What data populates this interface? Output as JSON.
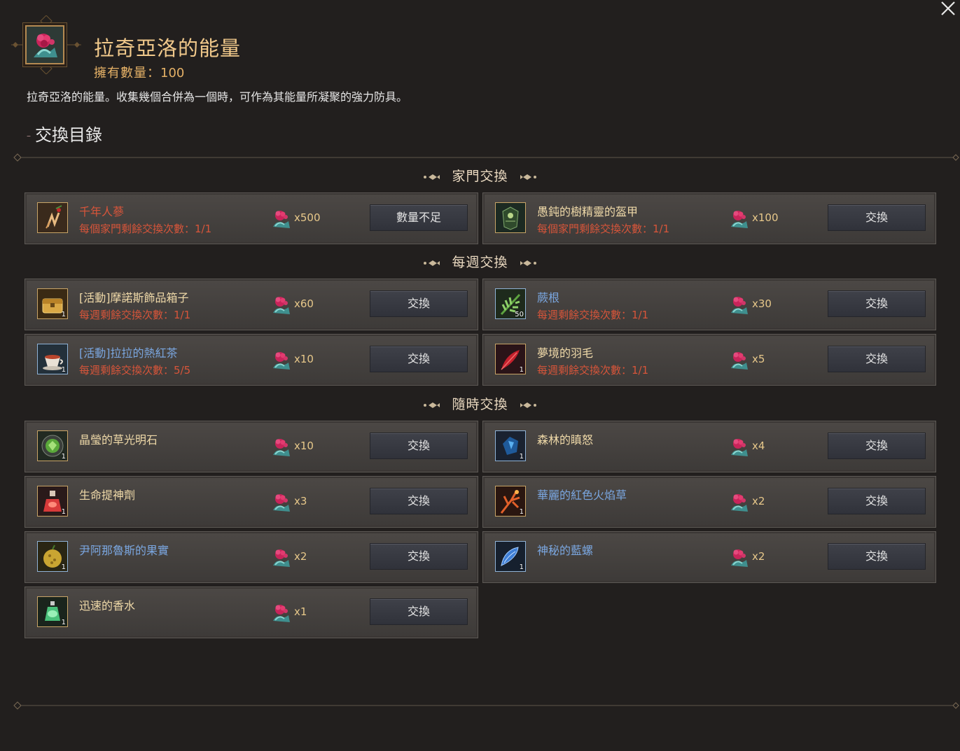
{
  "header": {
    "title": "拉奇亞洛的能量",
    "count_label": "擁有數量：",
    "count_value": "100",
    "description": "拉奇亞洛的能量。收集幾個合併為一個時，可作為其能量所凝聚的強力防具。",
    "section_heading": "交換目錄",
    "icon": "flower-icon"
  },
  "colors": {
    "background": "#221f1e",
    "card": "#45413e",
    "gold_text": "#f1c98b",
    "limit_text": "#d7553a",
    "blue_text": "#7aa6df",
    "button": "#383a42"
  },
  "categories": [
    {
      "title": "家門交換",
      "items": [
        {
          "name": "千年人蔘",
          "limit": "每個家門剩餘交換次數：1/1",
          "cost": "x500",
          "button": "數量不足",
          "icon": "ginseng-icon",
          "name_color": "red"
        },
        {
          "name": "愚鈍的樹精靈的盔甲",
          "limit": "每個家門剩餘交換次數：1/1",
          "cost": "x100",
          "button": "交換",
          "icon": "armor-icon",
          "name_color": "gold"
        }
      ]
    },
    {
      "title": "每週交換",
      "items": [
        {
          "name": "[活動]摩諾斯飾品箱子",
          "limit": "每週剩餘交換次數：1/1",
          "cost": "x60",
          "button": "交換",
          "icon": "chest-icon",
          "stack": "1",
          "name_color": "gold"
        },
        {
          "name": "蕨根",
          "limit": "每週剩餘交換次數：1/1",
          "cost": "x30",
          "button": "交換",
          "icon": "fern-icon",
          "stack": "50",
          "name_color": "blue"
        },
        {
          "name": "[活動]拉拉的熱紅茶",
          "limit": "每週剩餘交換次數：5/5",
          "cost": "x10",
          "button": "交換",
          "icon": "tea-icon",
          "stack": "1",
          "name_color": "blue"
        },
        {
          "name": "夢境的羽毛",
          "limit": "每週剩餘交換次數：1/1",
          "cost": "x5",
          "button": "交換",
          "icon": "feather-icon",
          "stack": "1",
          "name_color": "gold"
        }
      ]
    },
    {
      "title": "隨時交換",
      "items": [
        {
          "name": "晶瑩的草光明石",
          "limit": "",
          "cost": "x10",
          "button": "交換",
          "icon": "green-stone-icon",
          "stack": "1",
          "name_color": "gold"
        },
        {
          "name": "森林的瞋怒",
          "limit": "",
          "cost": "x4",
          "button": "交換",
          "icon": "blue-stone-icon",
          "stack": "1",
          "name_color": "gold"
        },
        {
          "name": "生命提神劑",
          "limit": "",
          "cost": "x3",
          "button": "交換",
          "icon": "potion-icon",
          "stack": "1",
          "name_color": "gold"
        },
        {
          "name": "華麗的紅色火焰草",
          "limit": "",
          "cost": "x2",
          "button": "交換",
          "icon": "flame-herb-icon",
          "stack": "1",
          "name_color": "blue"
        },
        {
          "name": "尹阿那魯斯的果實",
          "limit": "",
          "cost": "x2",
          "button": "交換",
          "icon": "fruit-icon",
          "stack": "1",
          "name_color": "blue"
        },
        {
          "name": "神秘的藍螺",
          "limit": "",
          "cost": "x2",
          "button": "交換",
          "icon": "shell-icon",
          "stack": "1",
          "name_color": "blue"
        },
        {
          "name": "迅速的香水",
          "limit": "",
          "cost": "x1",
          "button": "交換",
          "icon": "perfume-icon",
          "stack": "1",
          "name_color": "gold"
        }
      ]
    }
  ]
}
